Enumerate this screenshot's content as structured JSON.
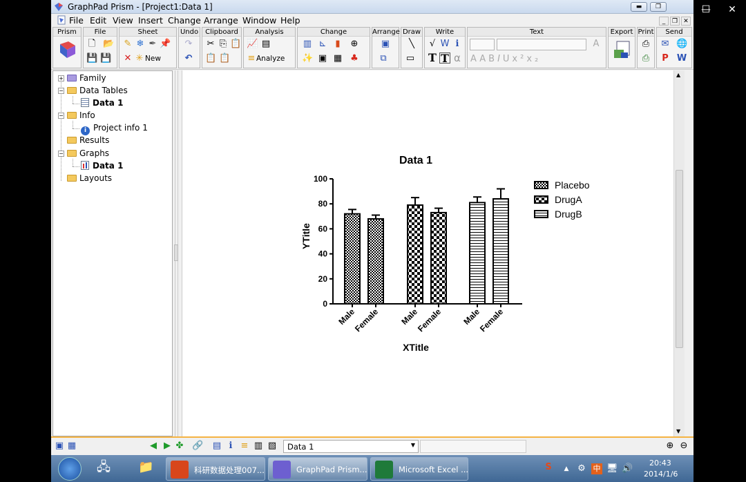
{
  "window": {
    "title": "GraphPad Prism - [Project1:Data 1]",
    "min": "—",
    "max": "❐",
    "close": "✕"
  },
  "menu": [
    "File",
    "Edit",
    "View",
    "Insert",
    "Change",
    "Arrange",
    "Window",
    "Help"
  ],
  "toolbar_groups": [
    "Prism",
    "File",
    "Sheet",
    "Undo",
    "Clipboard",
    "Analysis",
    "Change",
    "Arrange",
    "Draw",
    "Write",
    "Text",
    "Export",
    "Print",
    "Send"
  ],
  "toolbar": {
    "new_label": "New",
    "analyze_label": "Analyze"
  },
  "navigator": {
    "family": "Family",
    "data_tables": "Data Tables",
    "data1": "Data 1",
    "info": "Info",
    "project_info": "Project info 1",
    "results": "Results",
    "graphs": "Graphs",
    "graph1": "Data 1",
    "layouts": "Layouts"
  },
  "chart_data": {
    "type": "bar",
    "title": "Data 1",
    "xlabel": "XTitle",
    "ylabel": "YTitle",
    "ylim": [
      0,
      100
    ],
    "yticks": [
      0,
      20,
      40,
      60,
      80,
      100
    ],
    "legend_position": "right",
    "groups": [
      {
        "name": "Placebo",
        "pattern": "checker",
        "bars": [
          {
            "label": "Male",
            "value": 72,
            "err": 3.5
          },
          {
            "label": "Female",
            "value": 68,
            "err": 3
          }
        ]
      },
      {
        "name": "DrugA",
        "pattern": "checker-large",
        "bars": [
          {
            "label": "Male",
            "value": 79,
            "err": 6
          },
          {
            "label": "Female",
            "value": 73,
            "err": 3.5
          }
        ]
      },
      {
        "name": "DrugB",
        "pattern": "horizontal-lines",
        "bars": [
          {
            "label": "Male",
            "value": 81,
            "err": 4.5
          },
          {
            "label": "Female",
            "value": 84,
            "err": 8
          }
        ]
      }
    ]
  },
  "statusbar": {
    "sheet_select": "Data 1"
  },
  "taskbar": {
    "items": [
      "科研数据处理007...",
      "GraphPad Prism...",
      "Microsoft Excel ..."
    ],
    "time": "20:43",
    "date": "2014/1/6",
    "ime": "中"
  }
}
